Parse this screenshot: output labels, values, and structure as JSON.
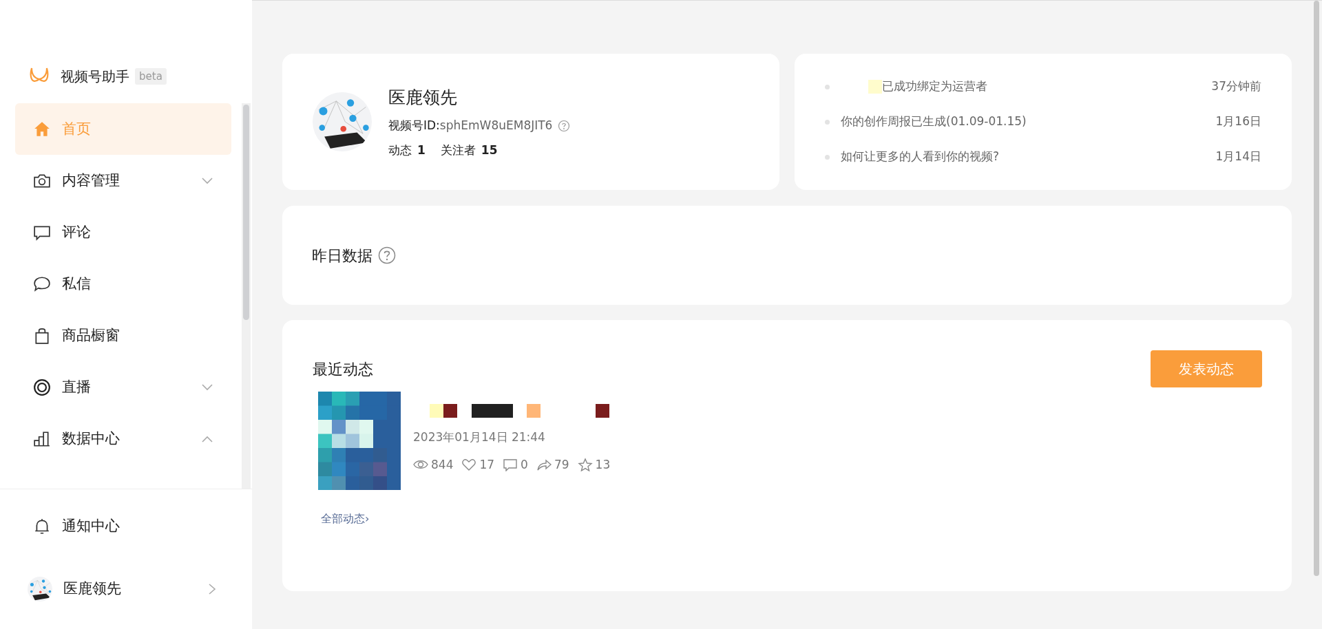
{
  "app": {
    "name": "视频号助手",
    "badge": "beta"
  },
  "nav": [
    {
      "label": "首页",
      "kind": "home",
      "selected": true
    },
    {
      "label": "内容管理",
      "kind": "camera",
      "selected": false,
      "expanded": false
    },
    {
      "label": "评论",
      "kind": "comment",
      "selected": false
    },
    {
      "label": "私信",
      "kind": "chat",
      "selected": false
    },
    {
      "label": "商品橱窗",
      "kind": "bag",
      "selected": false
    },
    {
      "label": "直播",
      "kind": "live",
      "selected": false,
      "expanded": false
    },
    {
      "label": "数据中心",
      "kind": "chart",
      "selected": false,
      "expanded": true
    }
  ],
  "bottom_nav": [
    {
      "label": "通知中心",
      "kind": "bell"
    }
  ],
  "account": {
    "name": "医鹿领先"
  },
  "profile": {
    "name": "医鹿领先",
    "id_label": "视频号ID:",
    "id_value": "sphEmW8uEM8JIT6",
    "stats": [
      {
        "label": "动态",
        "value": "1"
      },
      {
        "label": "关注者",
        "value": "15"
      }
    ]
  },
  "notifications": [
    {
      "text": "已成功绑定为运营者",
      "time": "37分钟前",
      "redacted": true
    },
    {
      "text": "你的创作周报已生成(01.09-01.15)",
      "time": "1月16日",
      "redacted": false
    },
    {
      "text": "如何让更多的人看到你的视频?",
      "time": "1月14日",
      "redacted": false
    }
  ],
  "yesterday": {
    "title": "昨日数据"
  },
  "recent": {
    "title": "最近动态",
    "button": "发表动态",
    "posts": [
      {
        "time": "2023年01月14日 21:44",
        "stats": [
          {
            "kind": "views",
            "value": "844"
          },
          {
            "kind": "likes",
            "value": "17"
          },
          {
            "kind": "comments",
            "value": "0"
          },
          {
            "kind": "shares",
            "value": "79"
          },
          {
            "kind": "favorites",
            "value": "13"
          }
        ]
      }
    ],
    "more": "全部动态›"
  }
}
